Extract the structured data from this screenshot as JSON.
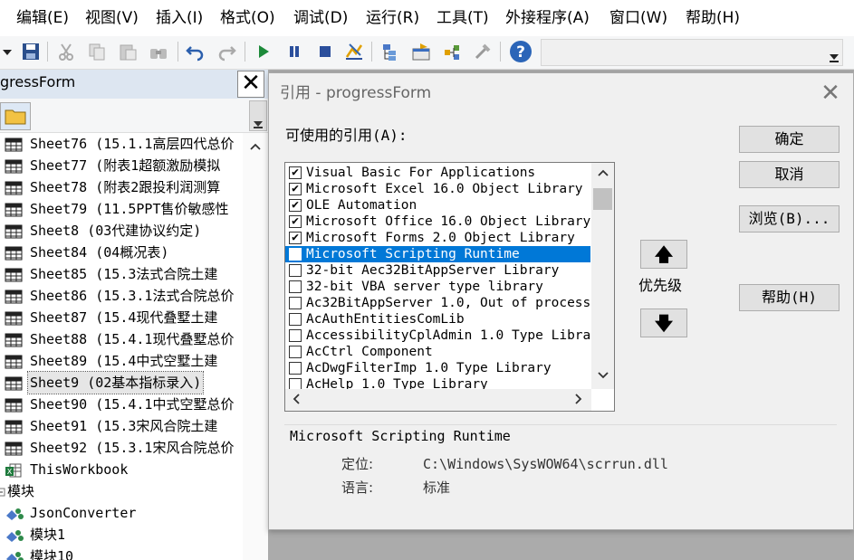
{
  "menu": [
    "编辑(E)",
    "视图(V)",
    "插入(I)",
    "格式(O)",
    "调试(D)",
    "运行(R)",
    "工具(T)",
    "外接程序(A)",
    "窗口(W)",
    "帮助(H)"
  ],
  "project_panel": {
    "title": "gressForm",
    "close_label": "✕",
    "items": [
      {
        "icon": "worksheet-icon",
        "label": "Sheet76 (15.1.1高层四代总价"
      },
      {
        "icon": "worksheet-icon",
        "label": "Sheet77 (附表1超额激励模拟"
      },
      {
        "icon": "worksheet-icon",
        "label": "Sheet78 (附表2跟投利润测算"
      },
      {
        "icon": "worksheet-icon",
        "label": "Sheet79 (11.5PPT售价敏感性"
      },
      {
        "icon": "worksheet-icon",
        "label": "Sheet8 (03代建协议约定)"
      },
      {
        "icon": "worksheet-icon",
        "label": "Sheet84 (04概况表)"
      },
      {
        "icon": "worksheet-icon",
        "label": "Sheet85 (15.3法式合院土建"
      },
      {
        "icon": "worksheet-icon",
        "label": "Sheet86 (15.3.1法式合院总价"
      },
      {
        "icon": "worksheet-icon",
        "label": "Sheet87 (15.4现代叠墅土建"
      },
      {
        "icon": "worksheet-icon",
        "label": "Sheet88 (15.4.1现代叠墅总价"
      },
      {
        "icon": "worksheet-icon",
        "label": "Sheet89 (15.4中式空墅土建"
      },
      {
        "icon": "worksheet-icon",
        "label": "Sheet9 (02基本指标录入)",
        "selected": true
      },
      {
        "icon": "worksheet-icon",
        "label": "Sheet90 (15.4.1中式空墅总价"
      },
      {
        "icon": "worksheet-icon",
        "label": "Sheet91 (15.3宋风合院土建"
      },
      {
        "icon": "worksheet-icon",
        "label": "Sheet92 (15.3.1宋风合院总价"
      },
      {
        "icon": "workbook-icon",
        "label": "ThisWorkbook"
      },
      {
        "icon": "folder-minus-icon",
        "label": "模块"
      },
      {
        "icon": "module-icon",
        "label": "JsonConverter"
      },
      {
        "icon": "module-icon",
        "label": "模块1"
      },
      {
        "icon": "module-icon",
        "label": "模块10"
      }
    ]
  },
  "dialog": {
    "title": "引用 - progressForm",
    "close_label": "✕",
    "available_label": "可使用的引用(A):",
    "references": [
      {
        "checked": true,
        "label": "Visual Basic For Applications"
      },
      {
        "checked": true,
        "label": "Microsoft Excel 16.0 Object Library"
      },
      {
        "checked": true,
        "label": "OLE Automation"
      },
      {
        "checked": true,
        "label": "Microsoft Office 16.0 Object Library"
      },
      {
        "checked": true,
        "label": "Microsoft Forms 2.0 Object Library"
      },
      {
        "checked": true,
        "label": "Microsoft Scripting Runtime",
        "selected": true
      },
      {
        "checked": false,
        "label": "32-bit Aec32BitAppServer Library"
      },
      {
        "checked": false,
        "label": "32-bit VBA server type library"
      },
      {
        "checked": false,
        "label": "Ac32BitAppServer 1.0, Out of process"
      },
      {
        "checked": false,
        "label": "AcAuthEntitiesComLib"
      },
      {
        "checked": false,
        "label": "AccessibilityCplAdmin 1.0 Type Library"
      },
      {
        "checked": false,
        "label": "AcCtrl Component"
      },
      {
        "checked": false,
        "label": "AcDwgFilterImp 1.0 Type Library"
      },
      {
        "checked": false,
        "label": "AcHelp 1.0 Type Library"
      }
    ],
    "buttons": {
      "ok": "确定",
      "cancel": "取消",
      "browse": "浏览(B)...",
      "help": "帮助(H)"
    },
    "priority_label": "优先级",
    "priority_up": "🡅",
    "priority_down": "🡇",
    "info": {
      "name": "Microsoft Scripting Runtime",
      "location_label": "定位:",
      "location_value": "C:\\Windows\\SysWOW64\\scrrun.dll",
      "language_label": "语言:",
      "language_value": "标准"
    }
  },
  "colors": {
    "selection": "#0078d7",
    "panel_title": "#dde6f1",
    "mdi_background": "#ababab"
  }
}
